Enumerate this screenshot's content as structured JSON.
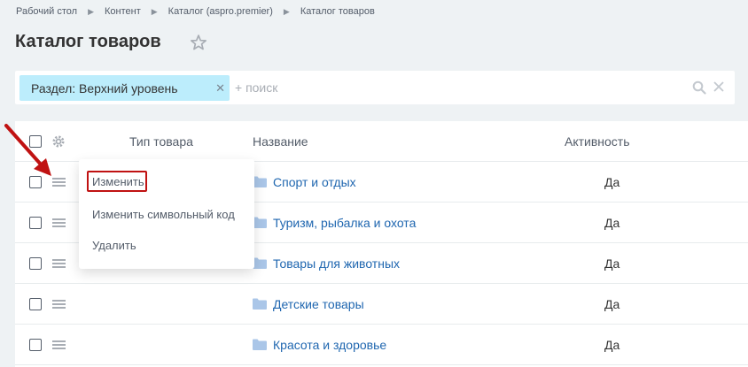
{
  "breadcrumb": [
    "Рабочий стол",
    "Контент",
    "Каталог (aspro.premier)",
    "Каталог товаров"
  ],
  "page": {
    "title": "Каталог товаров"
  },
  "filter": {
    "chip_label": "Раздел: Верхний уровень",
    "placeholder": "+ поиск"
  },
  "table": {
    "headers": {
      "type": "Тип товара",
      "name": "Название",
      "active": "Активность"
    },
    "rows": [
      {
        "name": "Спорт и отдых",
        "active": "Да"
      },
      {
        "name": "Туризм, рыбалка и охота",
        "active": "Да"
      },
      {
        "name": "Товары для животных",
        "active": "Да"
      },
      {
        "name": "Детские товары",
        "active": "Да"
      },
      {
        "name": "Красота и здоровье",
        "active": "Да"
      }
    ]
  },
  "context_menu": {
    "items": [
      "Изменить",
      "Изменить символьный код",
      "Удалить"
    ]
  },
  "colors": {
    "link": "#2067b0",
    "chip": "#bcedfc",
    "annotation": "#c01212",
    "folder": "#aac6e8"
  },
  "icons": [
    "star-icon",
    "search-icon",
    "clear-icon",
    "gear-icon",
    "menu-icon",
    "folder-icon",
    "arrow-annotation"
  ]
}
